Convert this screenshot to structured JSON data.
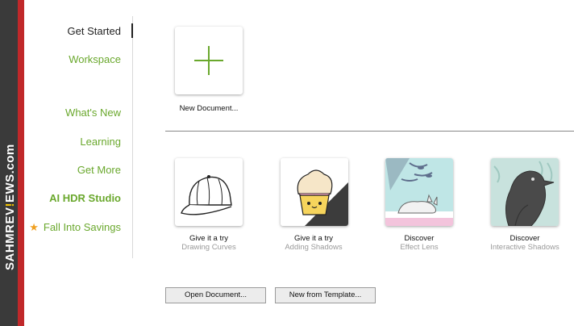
{
  "watermark": {
    "prefix": "SAHMREV",
    "mark": "!",
    "suffix": "EWS.com"
  },
  "sidebar": {
    "items": [
      {
        "label": "Get Started"
      },
      {
        "label": "Workspace"
      },
      {
        "label": "What's New"
      },
      {
        "label": "Learning"
      },
      {
        "label": "Get More"
      },
      {
        "label": "AI HDR Studio"
      },
      {
        "label": "Fall Into Savings",
        "icon": "star-icon"
      }
    ]
  },
  "main": {
    "new_document": {
      "label": "New Document..."
    },
    "tutorials": [
      {
        "title": "Give it a try",
        "subtitle": "Drawing Curves"
      },
      {
        "title": "Give it a try",
        "subtitle": "Adding Shadows"
      },
      {
        "title": "Discover",
        "subtitle": "Effect Lens"
      },
      {
        "title": "Discover",
        "subtitle": "Interactive Shadows"
      }
    ],
    "buttons": {
      "open": "Open Document...",
      "template": "New from Template..."
    }
  },
  "colors": {
    "accent": "#6aa82d",
    "brand_red": "#c0282a"
  }
}
